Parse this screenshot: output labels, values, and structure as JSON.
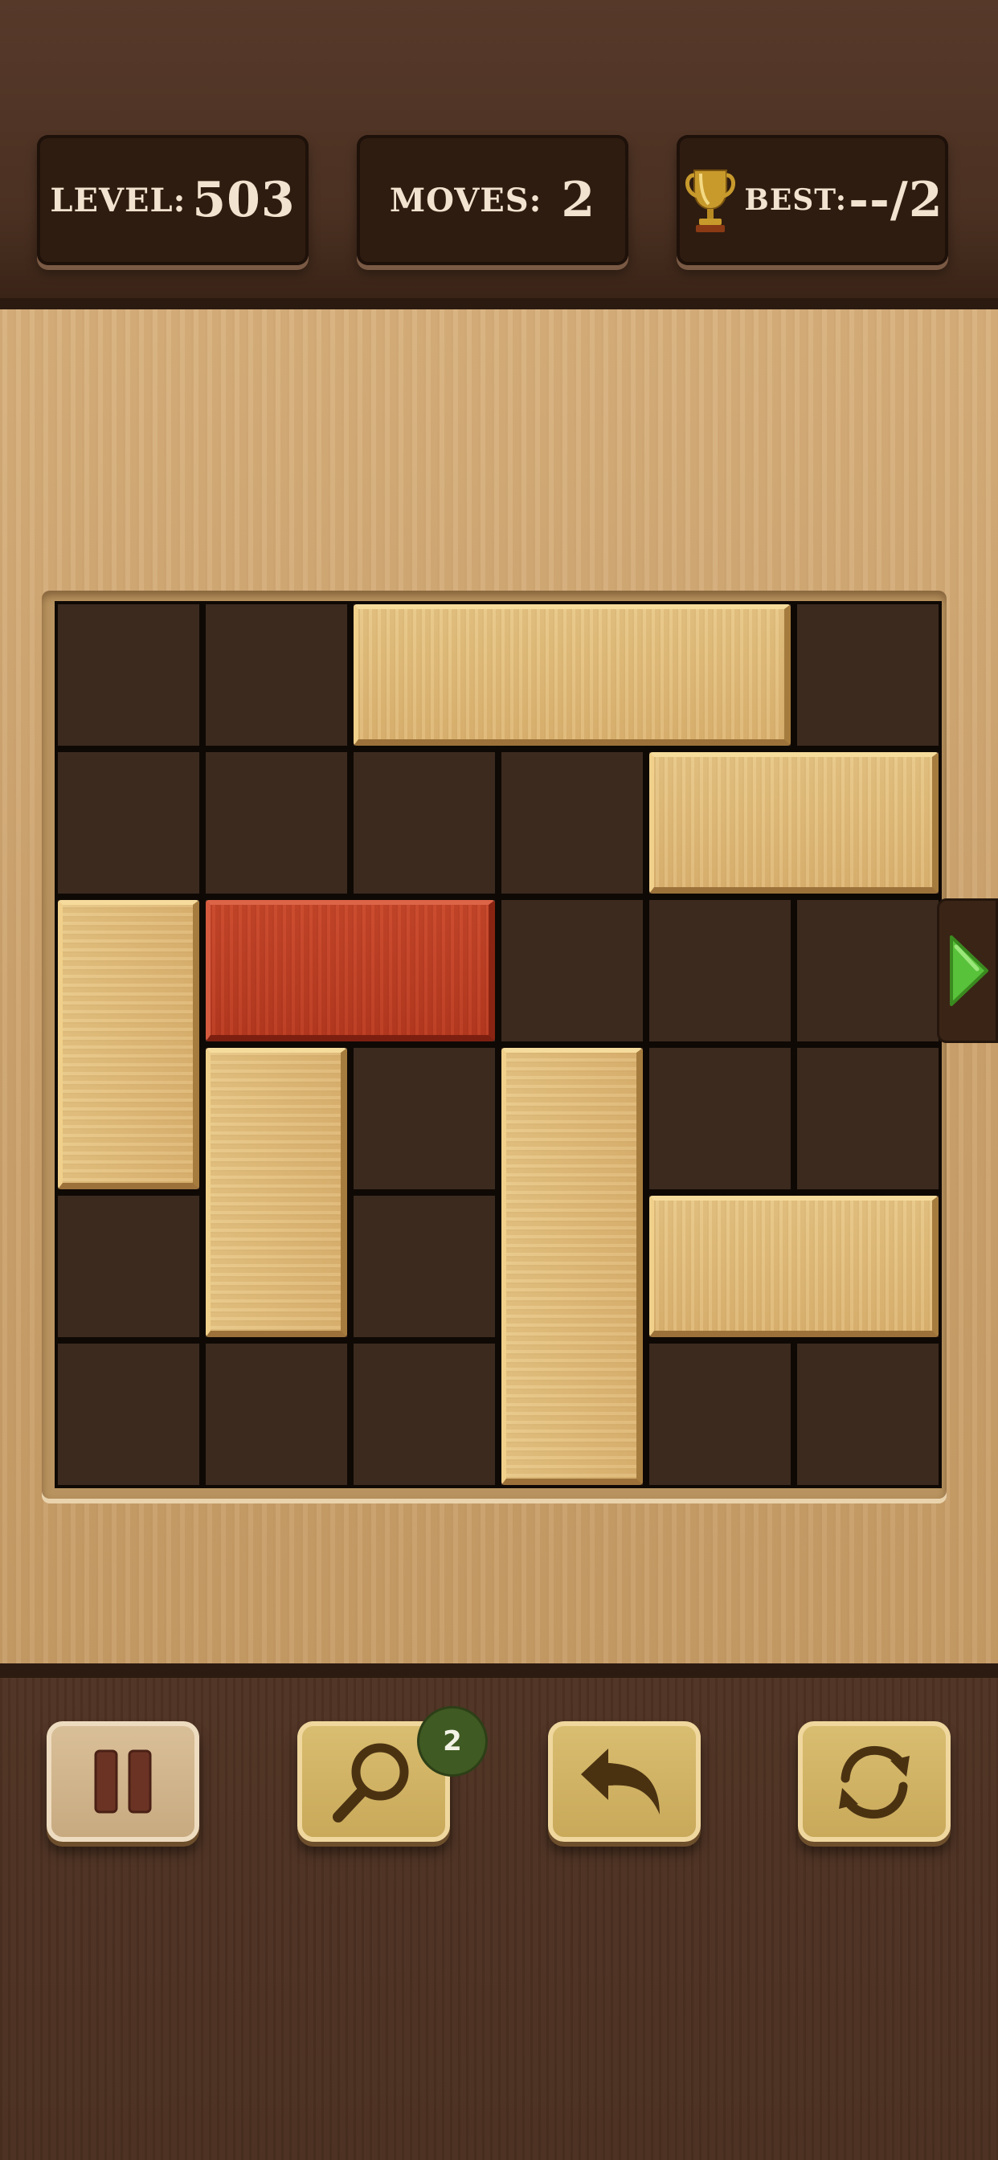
{
  "header": {
    "level_label": "LEVEL:",
    "level_value": "503",
    "moves_label": "MOVES:",
    "moves_value": "2",
    "best_label": "BEST:",
    "best_value": "--/2"
  },
  "controls": {
    "hint_count": "2",
    "icons": [
      "pause-icon",
      "magnifier-icon",
      "undo-arrow-icon",
      "restart-icon"
    ]
  },
  "board": {
    "size": 6,
    "exit_row": 2,
    "blocks": [
      {
        "id": "h-top",
        "row": 0,
        "col": 2,
        "len": 3,
        "dir": "h",
        "color": "wood"
      },
      {
        "id": "h-right-1",
        "row": 1,
        "col": 4,
        "len": 2,
        "dir": "h",
        "color": "wood"
      },
      {
        "id": "target",
        "row": 2,
        "col": 1,
        "len": 2,
        "dir": "h",
        "color": "red"
      },
      {
        "id": "v-left",
        "row": 2,
        "col": 0,
        "len": 2,
        "dir": "v",
        "color": "wood"
      },
      {
        "id": "v-mid-left",
        "row": 3,
        "col": 1,
        "len": 2,
        "dir": "v",
        "color": "wood"
      },
      {
        "id": "v-center",
        "row": 3,
        "col": 3,
        "len": 3,
        "dir": "v",
        "color": "wood"
      },
      {
        "id": "h-right-2",
        "row": 4,
        "col": 4,
        "len": 2,
        "dir": "h",
        "color": "wood"
      }
    ]
  },
  "colors": {
    "wood": "#dcb472",
    "target": "#b83a20",
    "exit_arrow": "#58c23a",
    "cell": "#3c2a1f"
  }
}
